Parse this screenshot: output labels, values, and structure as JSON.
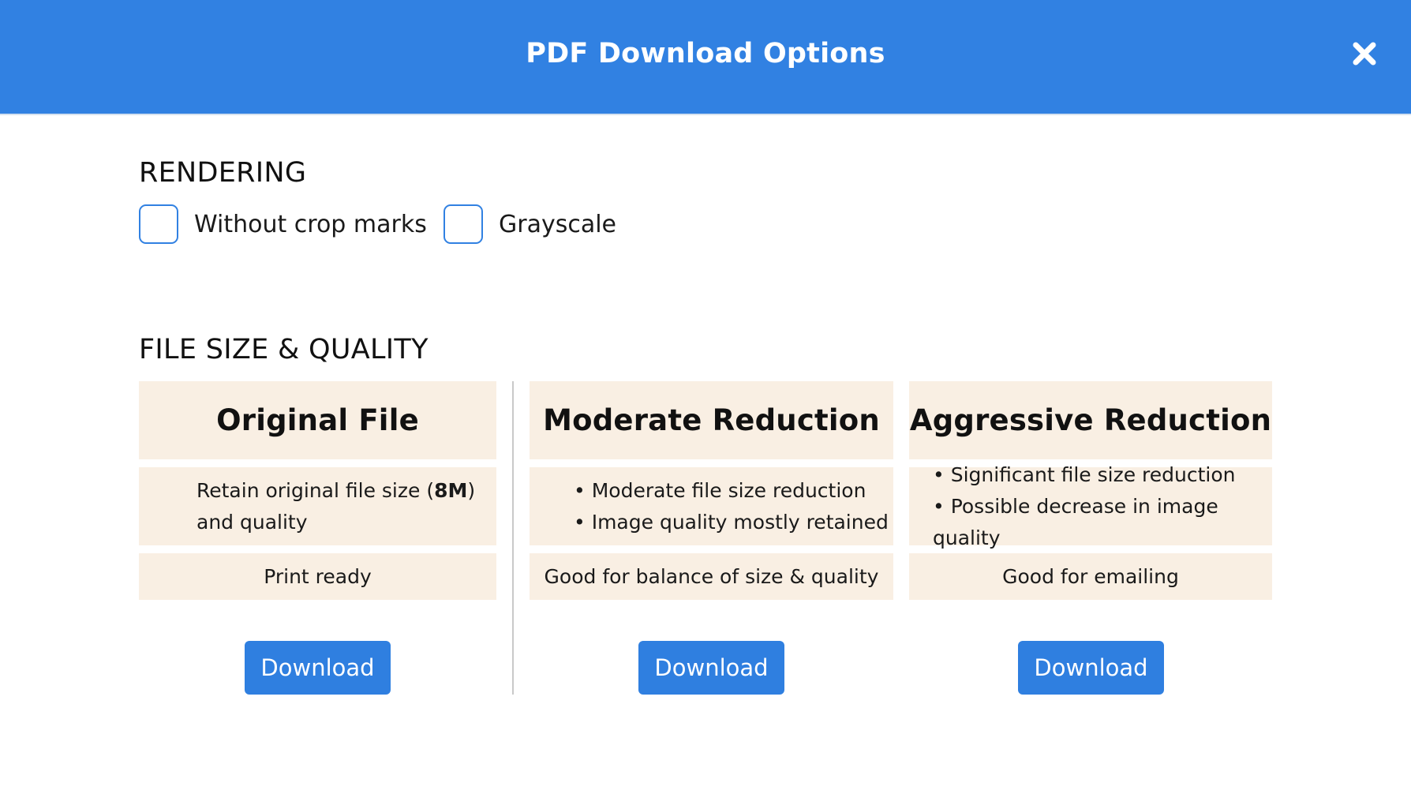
{
  "header": {
    "title": "PDF Download Options",
    "close_icon": "close-icon",
    "background_color": "#3181e2"
  },
  "rendering": {
    "title": "RENDERING",
    "options": [
      {
        "label": "Without crop marks",
        "checked": false
      },
      {
        "label": "Grayscale",
        "checked": false
      }
    ]
  },
  "quality": {
    "title": "FILE SIZE & QUALITY",
    "cards": [
      {
        "title": "Original File",
        "description_prefix": "Retain original file size (",
        "description_bold": "8M",
        "description_suffix": ")",
        "description_line2": "and quality",
        "good_for": "Print ready",
        "button_label": "Download"
      },
      {
        "title": "Moderate Reduction",
        "bullets": [
          "Moderate file size reduction",
          "Image quality mostly retained"
        ],
        "good_for": "Good for balance of size & quality",
        "button_label": "Download"
      },
      {
        "title": "Aggressive Reduction",
        "bullets": [
          "Significant file size reduction",
          "Possible decrease in image quality"
        ],
        "good_for": "Good for emailing",
        "button_label": "Download"
      }
    ]
  },
  "colors": {
    "accent": "#3181e2",
    "card_background": "#f9efe3",
    "divider": "#c9c9c9"
  }
}
